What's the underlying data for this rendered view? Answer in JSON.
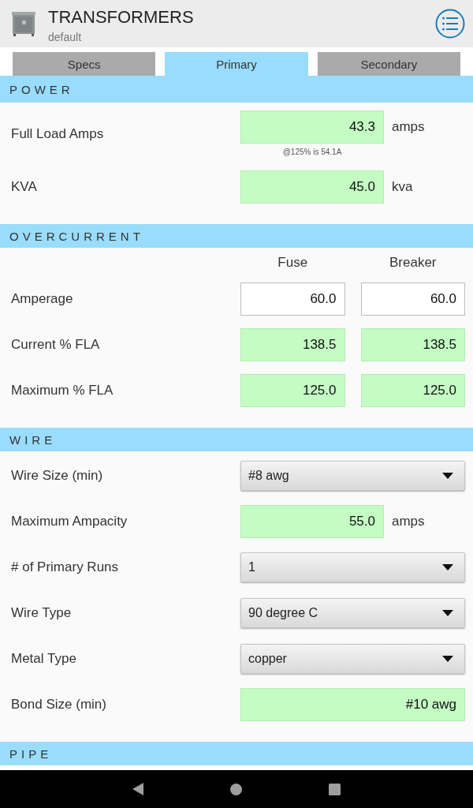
{
  "app_bar": {
    "title": "TRANSFORMERS",
    "subtitle": "default"
  },
  "tabs": [
    {
      "label": "Specs",
      "selected": false
    },
    {
      "label": "Primary",
      "selected": true
    },
    {
      "label": "Secondary",
      "selected": false
    }
  ],
  "sections": [
    {
      "title": "POWER",
      "rows": [
        {
          "kind": "readout",
          "label": "Full Load Amps",
          "value": "43.3",
          "unit": "amps",
          "note": "@125% is 54.1A"
        },
        {
          "kind": "readout",
          "label": "KVA",
          "value": "45.0",
          "unit": "kva"
        }
      ]
    },
    {
      "title": "OVERCURRENT",
      "columns": [
        "Fuse",
        "Breaker"
      ],
      "rows": [
        {
          "kind": "pair",
          "label": "Amperage",
          "cells": [
            {
              "kind": "input",
              "value": "60.0"
            },
            {
              "kind": "input",
              "value": "60.0"
            }
          ]
        },
        {
          "kind": "pair",
          "label": "Current % FLA",
          "cells": [
            {
              "kind": "readout",
              "value": "138.5"
            },
            {
              "kind": "readout",
              "value": "138.5"
            }
          ]
        },
        {
          "kind": "pair",
          "label": "Maximum % FLA",
          "cells": [
            {
              "kind": "readout",
              "value": "125.0"
            },
            {
              "kind": "readout",
              "value": "125.0"
            }
          ]
        }
      ]
    },
    {
      "title": "WIRE",
      "rows": [
        {
          "kind": "select",
          "label": "Wire Size (min)",
          "value": "#8 awg"
        },
        {
          "kind": "readout",
          "label": "Maximum Ampacity",
          "value": "55.0",
          "unit": "amps"
        },
        {
          "kind": "select",
          "label": "# of Primary Runs",
          "value": "1"
        },
        {
          "kind": "select",
          "label": "Wire Type",
          "value": "90 degree C"
        },
        {
          "kind": "select",
          "label": "Metal Type",
          "value": "copper"
        },
        {
          "kind": "readout",
          "label": "Bond Size (min)",
          "value": "#10 awg"
        }
      ]
    },
    {
      "title": "PIPE"
    }
  ]
}
